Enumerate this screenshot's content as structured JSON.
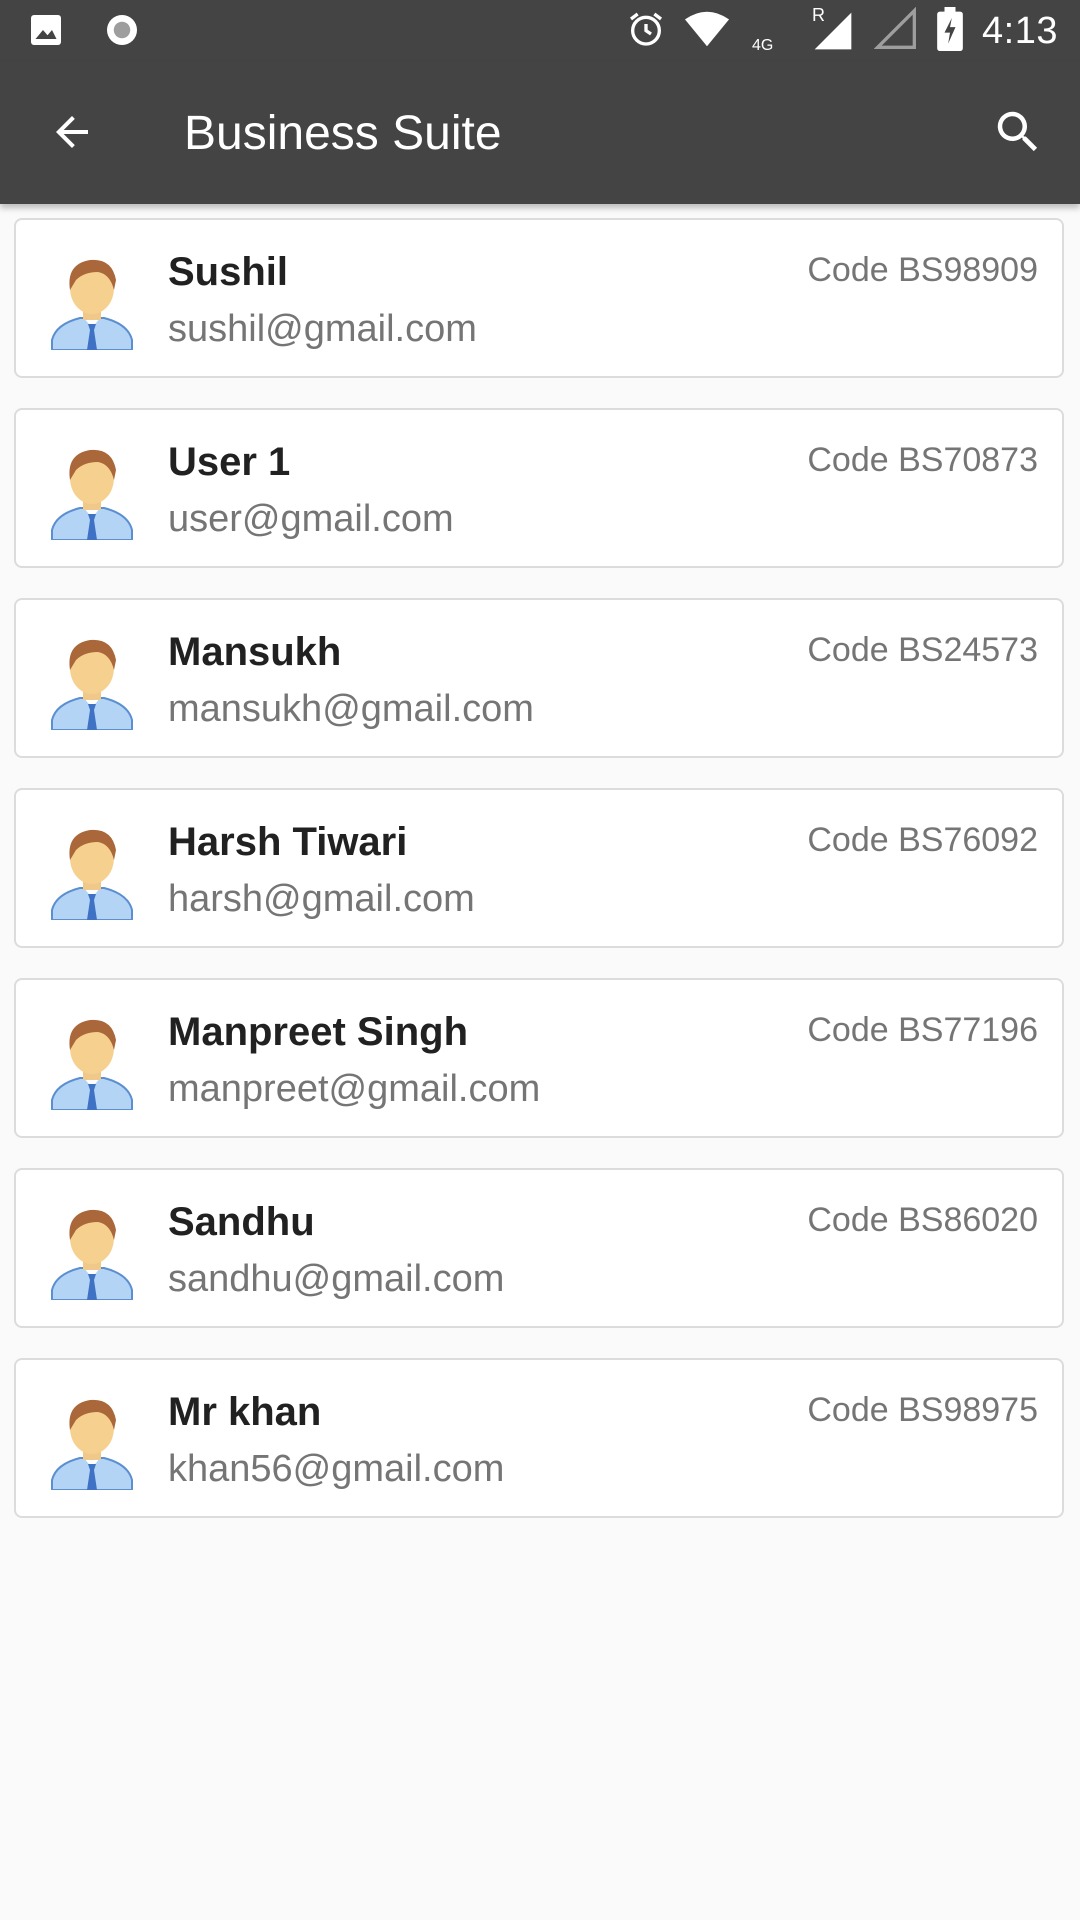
{
  "status_bar": {
    "time": "4:13",
    "network_type": "4G",
    "roaming_indicator": "R",
    "icons": [
      "image-icon",
      "record-icon",
      "alarm-icon",
      "wifi-icon",
      "signal-icon",
      "signal-empty-icon",
      "battery-charging-icon"
    ]
  },
  "app_bar": {
    "title": "Business Suite",
    "back_icon": "arrow-left-icon",
    "search_icon": "search-icon"
  },
  "contacts": [
    {
      "name": "Sushil",
      "email": "sushil@gmail.com",
      "code": "Code BS98909"
    },
    {
      "name": "User 1",
      "email": "user@gmail.com",
      "code": "Code BS70873"
    },
    {
      "name": "Mansukh",
      "email": "mansukh@gmail.com",
      "code": "Code BS24573"
    },
    {
      "name": "Harsh Tiwari",
      "email": "harsh@gmail.com",
      "code": "Code BS76092"
    },
    {
      "name": "Manpreet Singh",
      "email": "manpreet@gmail.com",
      "code": "Code BS77196"
    },
    {
      "name": "Sandhu",
      "email": "sandhu@gmail.com",
      "code": "Code BS86020"
    },
    {
      "name": "Mr khan",
      "email": "khan56@gmail.com",
      "code": "Code BS98975"
    }
  ],
  "colors": {
    "app_bar": "#444444",
    "background": "#fafafa",
    "card_border": "#dcdcdc",
    "name_text": "#212121",
    "secondary_text": "#757575"
  }
}
